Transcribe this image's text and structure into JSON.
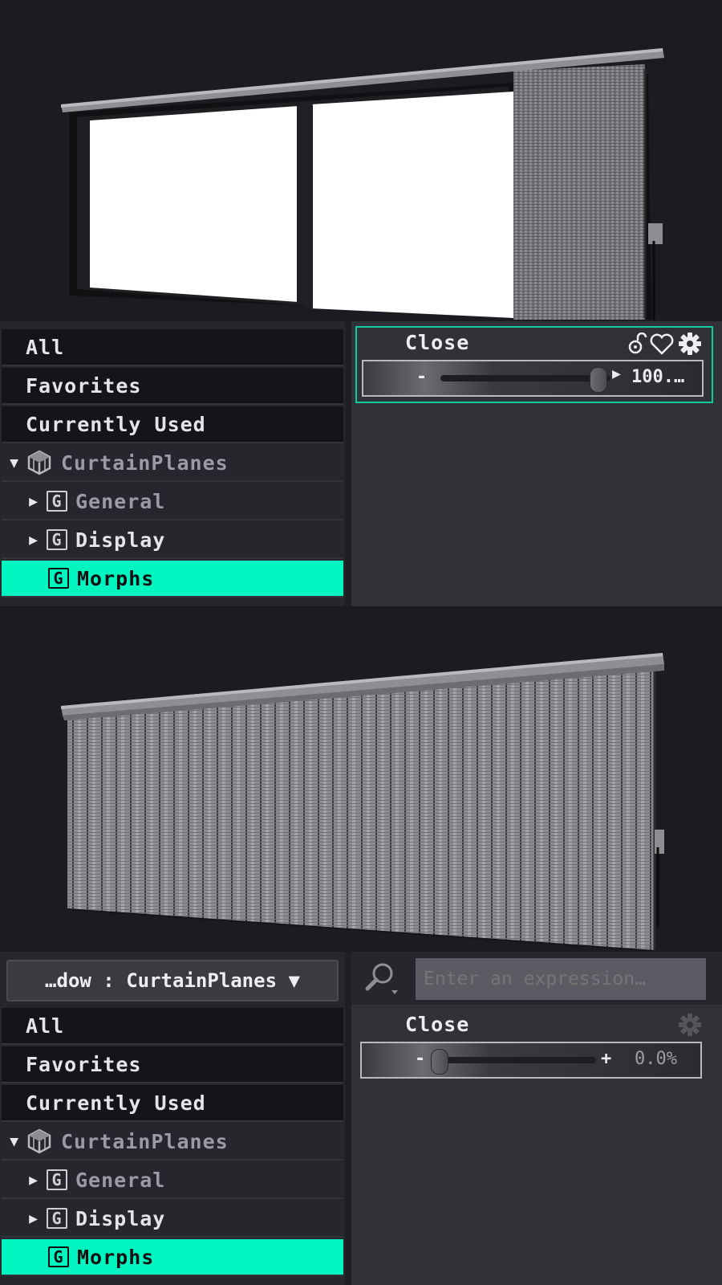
{
  "top_state": {
    "tree": {
      "items": [
        {
          "label": "All"
        },
        {
          "label": "Favorites"
        },
        {
          "label": "Currently Used"
        },
        {
          "label": "CurtainPlanes"
        },
        {
          "label": "General"
        },
        {
          "label": "Display"
        },
        {
          "label": "Morphs"
        }
      ],
      "group_glyph": "G"
    },
    "property": {
      "label": "Close",
      "minus": "-",
      "value_display": "100.…",
      "value_fraction": 1.0
    }
  },
  "bottom_state": {
    "node_selector": {
      "label": "…dow : CurtainPlanes ▼"
    },
    "search": {
      "placeholder": "Enter an expression…"
    },
    "tree": {
      "items": [
        {
          "label": "All"
        },
        {
          "label": "Favorites"
        },
        {
          "label": "Currently Used"
        },
        {
          "label": "CurtainPlanes"
        },
        {
          "label": "General"
        },
        {
          "label": "Display"
        },
        {
          "label": "Morphs"
        }
      ],
      "group_glyph": "G"
    },
    "property": {
      "label": "Close",
      "minus": "-",
      "plus": "+",
      "value_display": "0.0%",
      "value_fraction": 0.0
    }
  },
  "colors": {
    "accent": "#00f5c0",
    "background": "#1b1c21",
    "panel": "#313238"
  },
  "icons": [
    "cube-icon",
    "lock-icon",
    "heart-icon",
    "gear-icon",
    "search-icon",
    "expand-triangle-icon",
    "group-icon"
  ]
}
